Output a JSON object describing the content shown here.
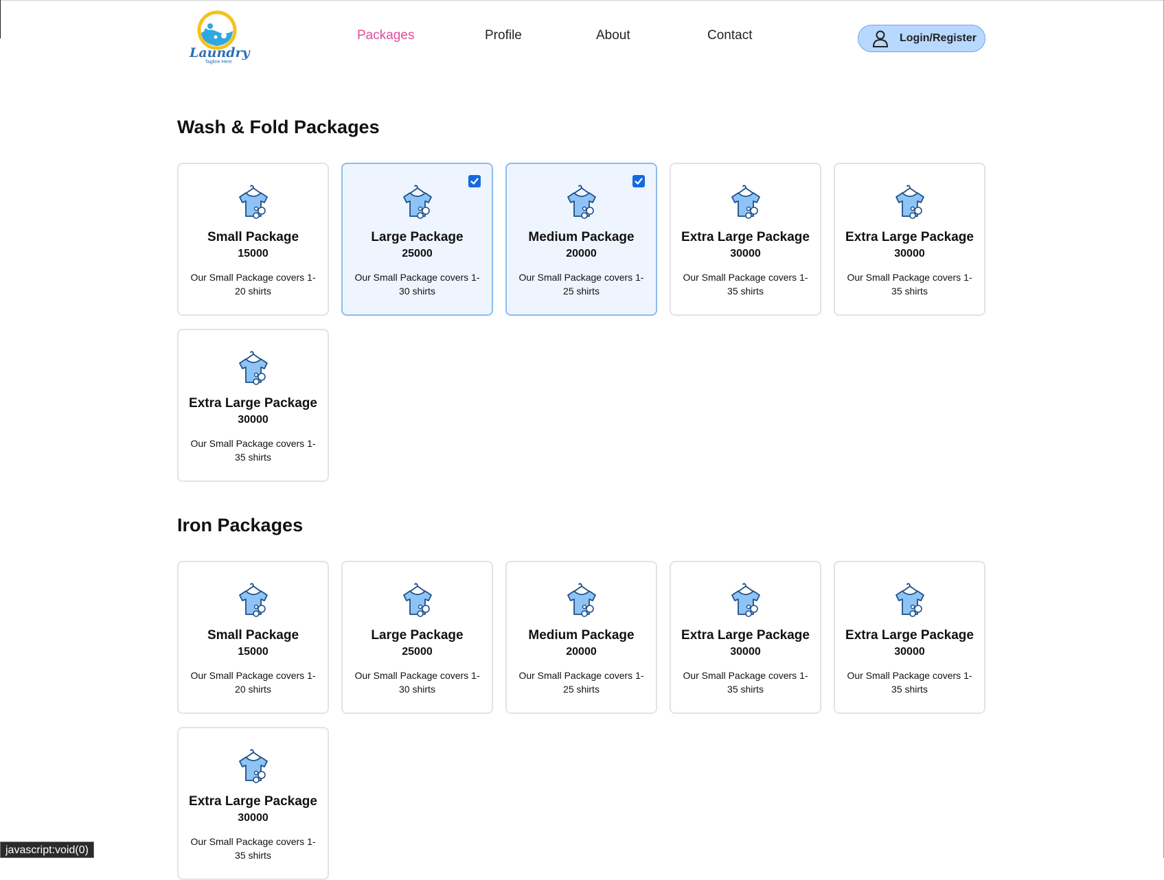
{
  "brand": {
    "logo_text": "Laundry",
    "tagline": "Tagline Here"
  },
  "nav": {
    "items": [
      {
        "label": "Packages",
        "active": true
      },
      {
        "label": "Profile",
        "active": false
      },
      {
        "label": "About",
        "active": false
      },
      {
        "label": "Contact",
        "active": false
      }
    ],
    "login_label": "Login/Register"
  },
  "colors": {
    "accent": "#e34b9a",
    "login_bg": "#b7d8ff",
    "selected_bg": "#eef5ff",
    "checkbox": "#1768e0",
    "icon_fill": "#8ec3f5",
    "icon_stroke": "#1f4f86"
  },
  "sections": [
    {
      "title": "Wash & Fold Packages",
      "packages": [
        {
          "name": "Small Package",
          "price": "15000",
          "description": "Our Small Package covers 1-20 shirts",
          "selected": false
        },
        {
          "name": "Large Package",
          "price": "25000",
          "description": "Our Small Package covers 1-30 shirts",
          "selected": true
        },
        {
          "name": "Medium Package",
          "price": "20000",
          "description": "Our Small Package covers 1-25 shirts",
          "selected": true
        },
        {
          "name": "Extra Large Package",
          "price": "30000",
          "description": "Our Small Package covers 1-35 shirts",
          "selected": false
        },
        {
          "name": "Extra Large Package",
          "price": "30000",
          "description": "Our Small Package covers 1-35 shirts",
          "selected": false
        },
        {
          "name": "Extra Large Package",
          "price": "30000",
          "description": "Our Small Package covers 1-35 shirts",
          "selected": false
        }
      ]
    },
    {
      "title": "Iron Packages",
      "packages": [
        {
          "name": "Small Package",
          "price": "15000",
          "description": "Our Small Package covers 1-20 shirts",
          "selected": false
        },
        {
          "name": "Large Package",
          "price": "25000",
          "description": "Our Small Package covers 1-30 shirts",
          "selected": false
        },
        {
          "name": "Medium Package",
          "price": "20000",
          "description": "Our Small Package covers 1-25 shirts",
          "selected": false
        },
        {
          "name": "Extra Large Package",
          "price": "30000",
          "description": "Our Small Package covers 1-35 shirts",
          "selected": false
        },
        {
          "name": "Extra Large Package",
          "price": "30000",
          "description": "Our Small Package covers 1-35 shirts",
          "selected": false
        },
        {
          "name": "Extra Large Package",
          "price": "30000",
          "description": "Our Small Package covers 1-35 shirts",
          "selected": false
        }
      ]
    }
  ],
  "status_bar": "javascript:void(0)"
}
